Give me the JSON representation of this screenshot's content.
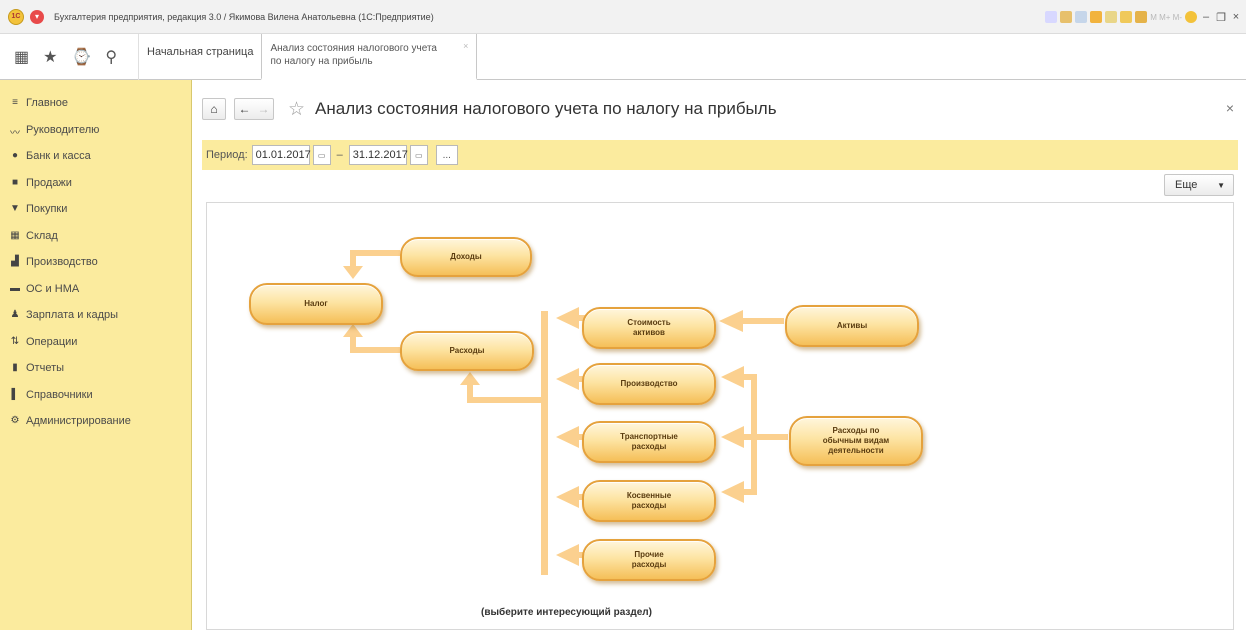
{
  "window": {
    "title": "Бухгалтерия предприятия, редакция 3.0 / Якимова Вилена Анатольевна (1С:Предприятие)",
    "logo_text": "1С",
    "tools_text": "M  M+  M-"
  },
  "toolbar": {
    "home_tab": "Начальная страница",
    "active_tab_line1": "Анализ состояния налогового учета",
    "active_tab_line2": "по налогу на прибыль",
    "close_glyph": "×"
  },
  "sidebar": {
    "items": [
      {
        "label": "Главное",
        "icon": "menu-icon"
      },
      {
        "label": "Руководителю",
        "icon": "trend-icon"
      },
      {
        "label": "Банк и касса",
        "icon": "bank-icon"
      },
      {
        "label": "Продажи",
        "icon": "bag-icon"
      },
      {
        "label": "Покупки",
        "icon": "cart-icon"
      },
      {
        "label": "Склад",
        "icon": "warehouse-icon"
      },
      {
        "label": "Производство",
        "icon": "factory-icon"
      },
      {
        "label": "ОС и НМА",
        "icon": "truck-icon"
      },
      {
        "label": "Зарплата и кадры",
        "icon": "person-icon"
      },
      {
        "label": "Операции",
        "icon": "operations-icon"
      },
      {
        "label": "Отчеты",
        "icon": "chart-icon"
      },
      {
        "label": "Справочники",
        "icon": "book-icon"
      },
      {
        "label": "Администрирование",
        "icon": "gear-icon"
      }
    ]
  },
  "page": {
    "title": "Анализ состояния налогового учета по налогу на прибыль",
    "close_glyph": "×",
    "period_label": "Период:",
    "date_from": "01.01.2017",
    "date_to": "31.12.2017",
    "dash": "–",
    "more_label": "...",
    "more_menu": "Еще",
    "hint": "(выберите интересующий раздел)"
  },
  "diagram": {
    "nodes": {
      "dohody": "Доходы",
      "nalog": "Налог",
      "rashody": "Расходы",
      "stoimost_1": "Стоимость",
      "stoimost_2": "активов",
      "aktivy": "Активы",
      "proizvodstvo": "Производство",
      "transport_1": "Транспортные",
      "transport_2": "расходы",
      "obychnye_1": "Расходы по",
      "obychnye_2": "обычным видам",
      "obychnye_3": "деятельности",
      "kosvennye_1": "Косвенные",
      "kosvennye_2": "расходы",
      "prochie_1": "Прочие",
      "prochie_2": "расходы"
    },
    "colors": {
      "arrow": "#fbd08f",
      "node_border": "#e5a23d",
      "node_fill": "#fde4a3"
    }
  },
  "colors": {
    "sidebar_bg": "#fbeb9e",
    "period_bg": "#fbeb9e"
  }
}
